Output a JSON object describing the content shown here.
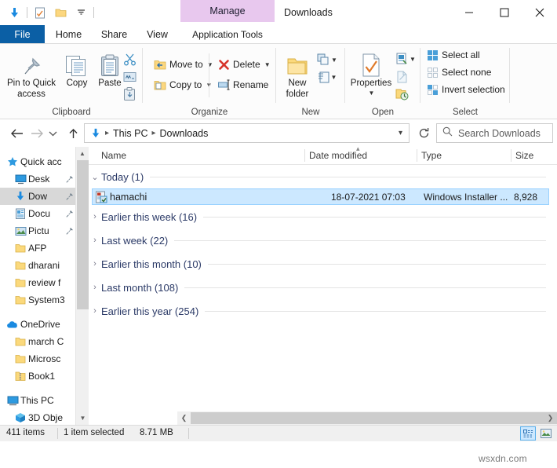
{
  "window": {
    "title": "Downloads",
    "controls": {
      "minimize": "minimize-icon",
      "maximize": "maximize-icon",
      "close": "close-icon"
    }
  },
  "quick_access_toolbar": {
    "items": [
      {
        "name": "downloads-arrow-icon",
        "icon": "download-arrow"
      },
      {
        "name": "properties-icon",
        "icon": "checked-document"
      },
      {
        "name": "new-folder-icon",
        "icon": "folder"
      },
      {
        "name": "customize-caret",
        "icon": "caret-down"
      }
    ]
  },
  "ribbon": {
    "contextual_tab": "Manage",
    "tabs": [
      {
        "label": "File",
        "active": false,
        "style": "file"
      },
      {
        "label": "Home",
        "active": true
      },
      {
        "label": "Share",
        "active": false
      },
      {
        "label": "View",
        "active": false
      },
      {
        "label": "Application Tools",
        "active": false,
        "contextual": true
      }
    ],
    "collapse_icon": "chevron-up-icon",
    "help_label": "?",
    "groups": [
      {
        "name": "Clipboard",
        "label": "Clipboard",
        "big_buttons": [
          {
            "label": "Pin to Quick\naccess",
            "line1": "Pin to Quick",
            "line2": "access",
            "icon": "pin-icon"
          },
          {
            "label": "Copy",
            "line1": "Copy",
            "line2": "",
            "icon": "copy-icon"
          },
          {
            "label": "Paste",
            "line1": "Paste",
            "line2": "",
            "icon": "paste-icon"
          }
        ],
        "tiny_buttons": [
          {
            "name": "cut-button",
            "icon": "scissors-icon"
          },
          {
            "name": "copy-path-button",
            "icon": "copy-path-icon"
          },
          {
            "name": "paste-shortcut-button",
            "icon": "paste-shortcut-icon"
          }
        ]
      },
      {
        "name": "Organize",
        "label": "Organize",
        "small_buttons": [
          {
            "label": "Move to",
            "icon": "move-to-icon",
            "has_caret": true
          },
          {
            "label": "Copy to",
            "icon": "copy-to-icon",
            "has_caret": true
          },
          {
            "label": "Delete",
            "icon": "delete-icon",
            "has_caret": true
          },
          {
            "label": "Rename",
            "icon": "rename-icon",
            "has_caret": false
          }
        ]
      },
      {
        "name": "New",
        "label": "New",
        "big_buttons": [
          {
            "line1": "New",
            "line2": "folder",
            "icon": "new-folder-icon"
          }
        ],
        "tiny_buttons": [
          {
            "name": "new-item-button",
            "icon": "new-item-icon",
            "has_caret": true
          },
          {
            "name": "easy-access-button",
            "icon": "easy-access-icon",
            "has_caret": true
          }
        ]
      },
      {
        "name": "Open",
        "label": "Open",
        "big_buttons": [
          {
            "line1": "Properties",
            "line2": "",
            "icon": "properties-icon",
            "has_caret": true
          }
        ],
        "tiny_buttons": [
          {
            "name": "open-button",
            "icon": "open-icon",
            "has_caret": true
          },
          {
            "name": "edit-button",
            "icon": "edit-icon"
          },
          {
            "name": "history-button",
            "icon": "history-icon"
          }
        ]
      },
      {
        "name": "Select",
        "label": "Select",
        "small_buttons": [
          {
            "label": "Select all",
            "icon": "select-all-icon"
          },
          {
            "label": "Select none",
            "icon": "select-none-icon"
          },
          {
            "label": "Invert selection",
            "icon": "invert-selection-icon"
          }
        ]
      }
    ]
  },
  "address_bar": {
    "back_icon": "back-arrow-icon",
    "forward_icon": "forward-arrow-icon",
    "recent_icon": "chevron-down-icon",
    "up_icon": "up-arrow-icon",
    "breadcrumb_icon": "download-arrow",
    "breadcrumbs": [
      "This PC",
      "Downloads"
    ],
    "dropdown_icon": "chevron-down-icon",
    "refresh_icon": "refresh-icon",
    "search_placeholder": "Search Downloads",
    "search_value": "",
    "search_icon": "search-icon"
  },
  "sidebar": {
    "items": [
      {
        "label": "Quick acc",
        "icon": "star-icon",
        "pinned": false,
        "selected": false,
        "indent": 6
      },
      {
        "label": "Desk",
        "icon": "desktop-icon",
        "pinned": true,
        "selected": false,
        "indent": 16
      },
      {
        "label": "Dow",
        "icon": "download-arrow",
        "pinned": true,
        "selected": true,
        "indent": 16
      },
      {
        "label": "Docu",
        "icon": "documents-icon",
        "pinned": true,
        "selected": false,
        "indent": 16
      },
      {
        "label": "Pictu",
        "icon": "pictures-icon",
        "pinned": true,
        "selected": false,
        "indent": 16
      },
      {
        "label": "AFP",
        "icon": "folder-icon",
        "pinned": false,
        "selected": false,
        "indent": 16
      },
      {
        "label": "dharani",
        "icon": "folder-icon",
        "pinned": false,
        "selected": false,
        "indent": 16
      },
      {
        "label": "review f",
        "icon": "folder-icon",
        "pinned": false,
        "selected": false,
        "indent": 16
      },
      {
        "label": "System3",
        "icon": "folder-icon",
        "pinned": false,
        "selected": false,
        "indent": 16
      },
      {
        "label": "OneDrive",
        "icon": "onedrive-icon",
        "pinned": false,
        "selected": false,
        "indent": 6
      },
      {
        "label": "march C",
        "icon": "folder-icon",
        "pinned": false,
        "selected": false,
        "indent": 16
      },
      {
        "label": "Microsc",
        "icon": "folder-icon",
        "pinned": false,
        "selected": false,
        "indent": 16
      },
      {
        "label": "Book1",
        "icon": "zip-icon",
        "pinned": false,
        "selected": false,
        "indent": 16
      },
      {
        "label": "This PC",
        "icon": "pc-icon",
        "pinned": false,
        "selected": false,
        "indent": 6
      },
      {
        "label": "3D Obje",
        "icon": "3d-objects-icon",
        "pinned": false,
        "selected": false,
        "indent": 16
      }
    ],
    "scroll_up_icon": "chevron-up-icon",
    "scroll_down_icon": "chevron-down-icon"
  },
  "file_list": {
    "columns": [
      {
        "label": "Name",
        "sorted": false
      },
      {
        "label": "Date modified",
        "sorted": true
      },
      {
        "label": "Type",
        "sorted": false
      },
      {
        "label": "Size",
        "sorted": false
      }
    ],
    "groups": [
      {
        "label": "Today (1)",
        "expanded": true,
        "count": 1
      },
      {
        "label": "Earlier this week (16)",
        "expanded": false,
        "count": 16
      },
      {
        "label": "Last week (22)",
        "expanded": false,
        "count": 22
      },
      {
        "label": "Earlier this month (10)",
        "expanded": false,
        "count": 10
      },
      {
        "label": "Last month (108)",
        "expanded": false,
        "count": 108
      },
      {
        "label": "Earlier this year (254)",
        "expanded": false,
        "count": 254
      }
    ],
    "rows": [
      {
        "name": "hamachi",
        "date_modified": "18-07-2021 07:03",
        "type": "Windows Installer ...",
        "size": "8,928",
        "icon": "msi-installer-icon",
        "selected": true
      }
    ],
    "h_scroll_left_icon": "chevron-left-icon",
    "h_scroll_right_icon": "chevron-right-icon"
  },
  "status_bar": {
    "item_count": "411 items",
    "selection": "1 item selected",
    "selection_size": "8.71 MB",
    "view_buttons": [
      {
        "name": "details-view-button",
        "icon": "details-view-icon",
        "active": true
      },
      {
        "name": "large-icons-view-button",
        "icon": "large-icons-view-icon",
        "active": false
      }
    ]
  },
  "watermark": "wsxdn.com",
  "colors": {
    "accent": "#0b5fa5",
    "contextual_tab": "#e8c8ee",
    "selection": "#cce8ff",
    "group_label": "#2b3a67"
  }
}
